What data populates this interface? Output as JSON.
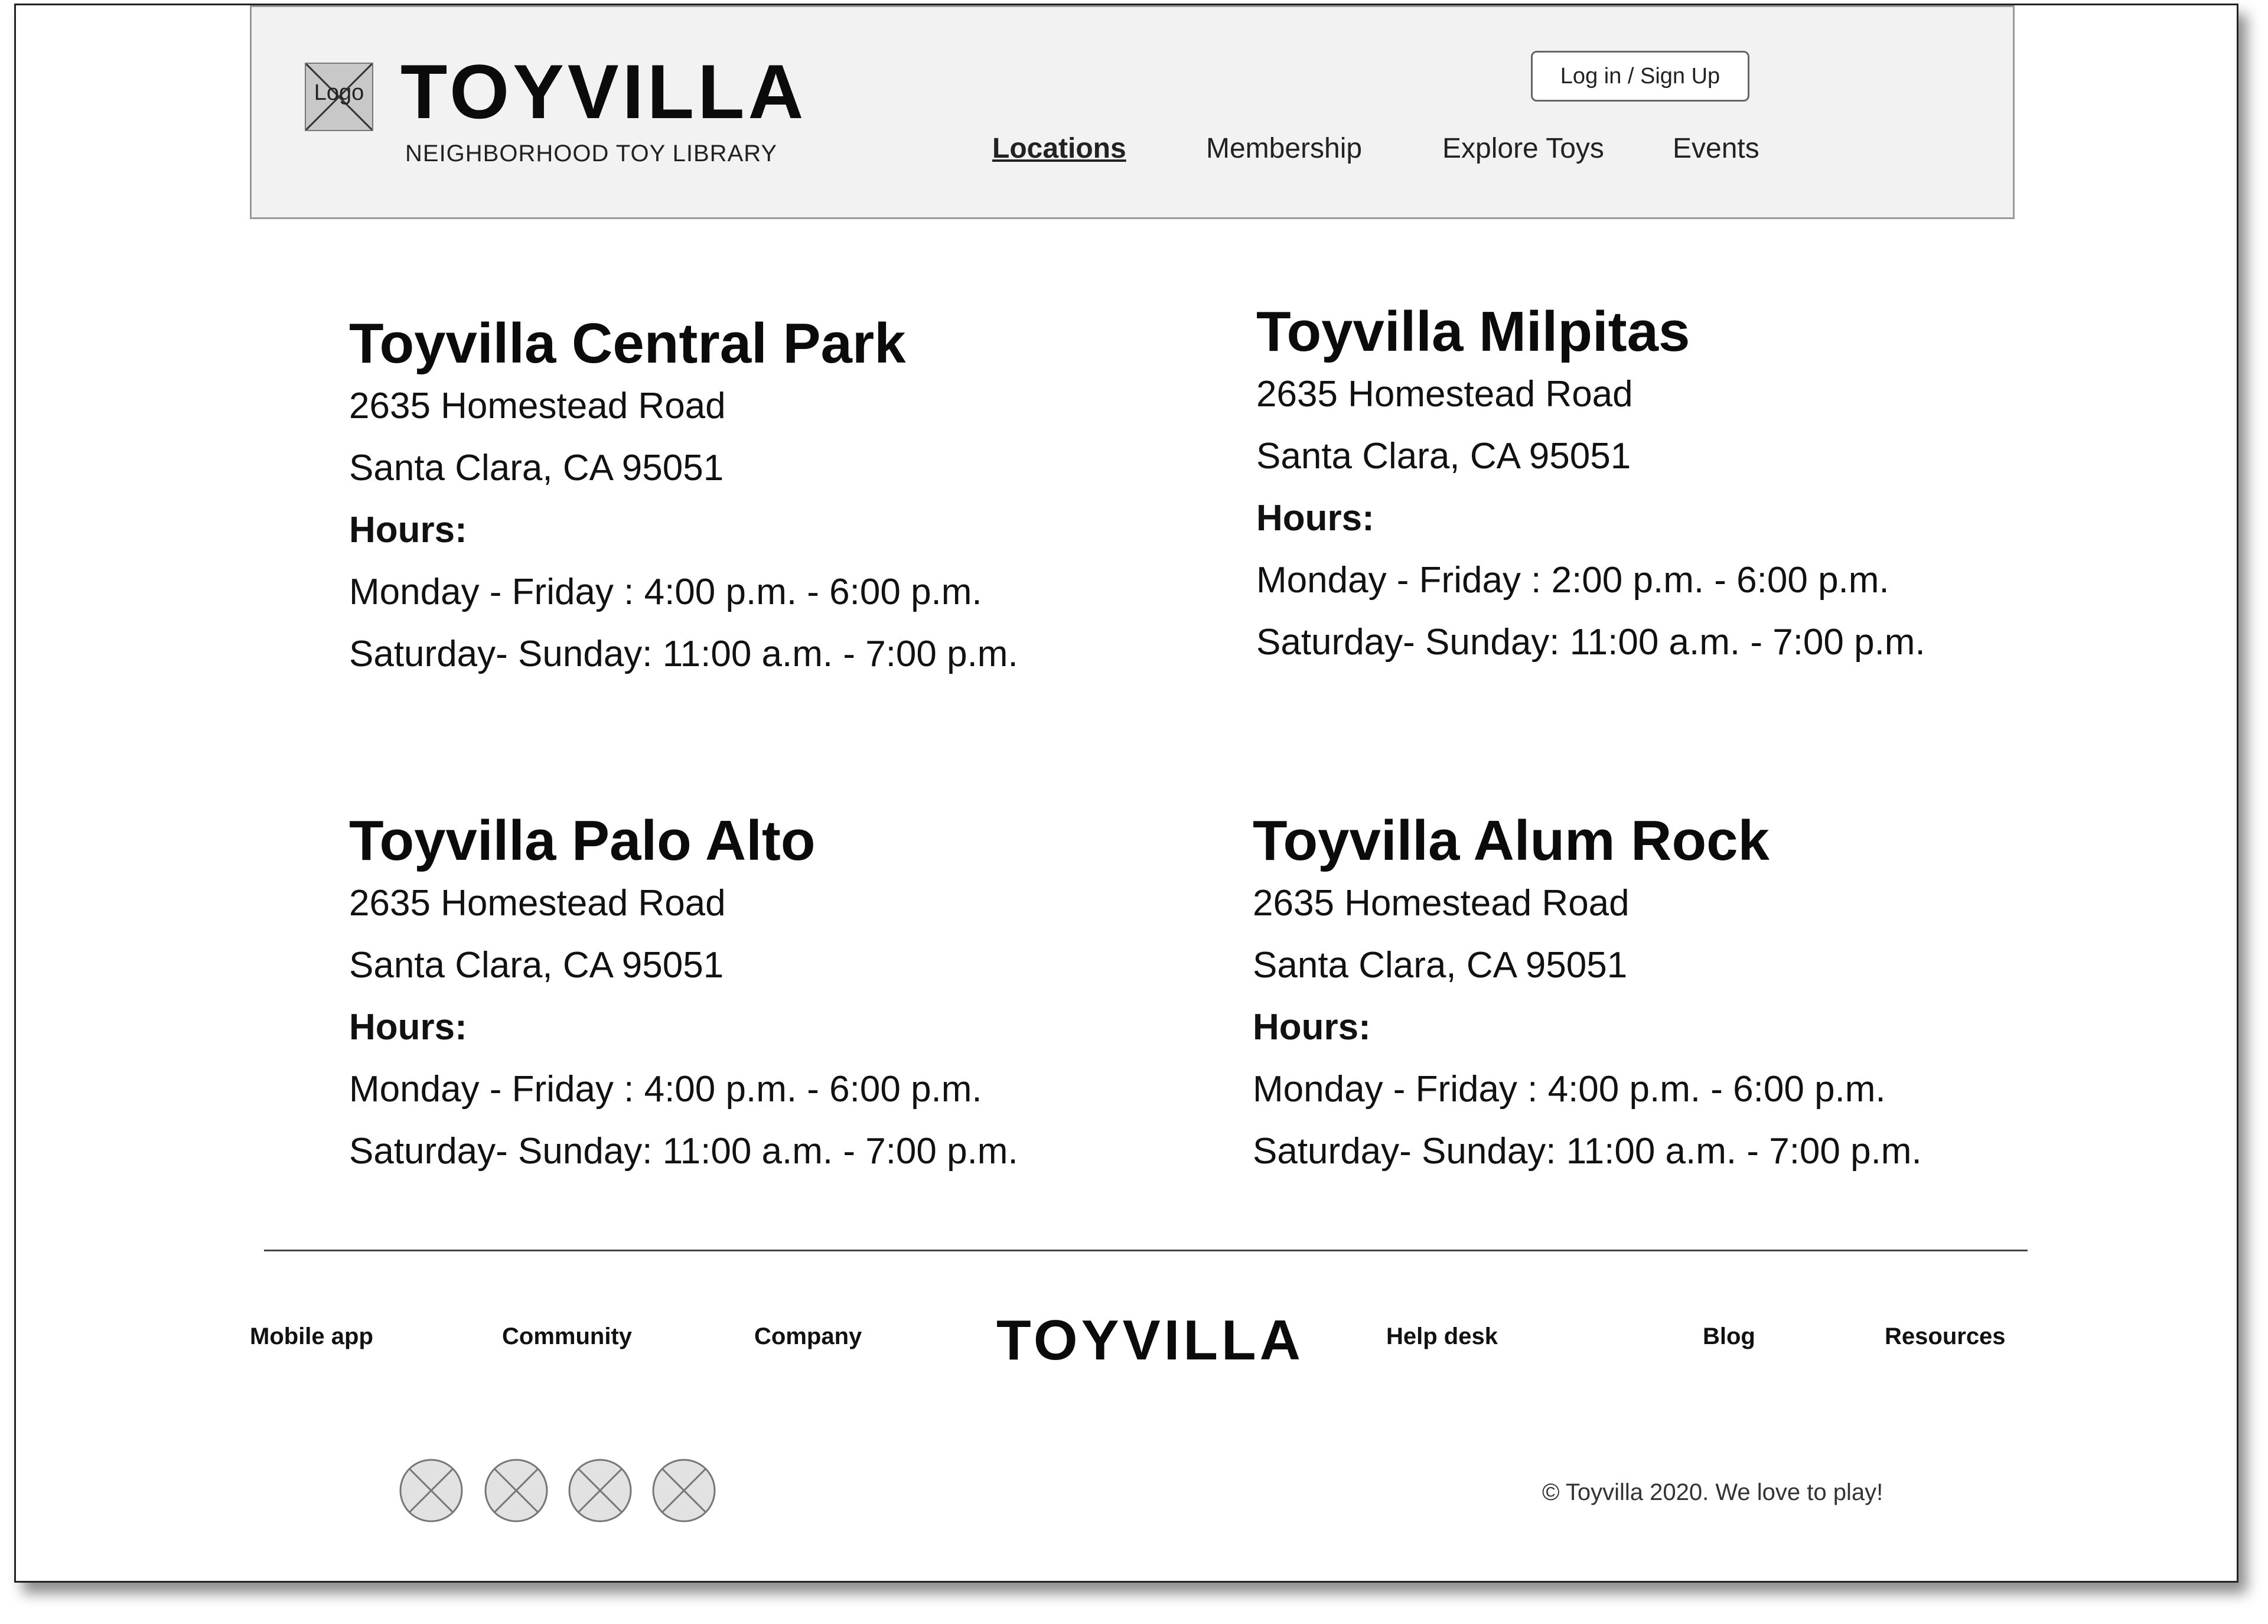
{
  "header": {
    "logo_placeholder": "Logo",
    "brand": "TOYVILLA",
    "tagline": "NEIGHBORHOOD TOY LIBRARY",
    "login_label": "Log in / Sign Up",
    "nav": [
      {
        "label": "Locations",
        "active": true
      },
      {
        "label": "Membership",
        "active": false
      },
      {
        "label": "Explore Toys",
        "active": false
      },
      {
        "label": "Events",
        "active": false
      }
    ]
  },
  "locations": [
    {
      "name": "Toyvilla Central Park",
      "address1": "2635 Homestead Road",
      "address2": "Santa Clara, CA 95051",
      "hours_label": "Hours:",
      "weekday": "Monday - Friday : 4:00 p.m. - 6:00 p.m.",
      "weekend": "Saturday- Sunday: 11:00 a.m. - 7:00 p.m."
    },
    {
      "name": "Toyvilla Milpitas",
      "address1": "2635 Homestead Road",
      "address2": "Santa Clara, CA 95051",
      "hours_label": "Hours:",
      "weekday": "Monday - Friday : 2:00 p.m. - 6:00 p.m.",
      "weekend": "Saturday- Sunday: 11:00 a.m. - 7:00 p.m."
    },
    {
      "name": "Toyvilla Palo Alto",
      "address1": "2635 Homestead Road",
      "address2": "Santa Clara, CA 95051",
      "hours_label": "Hours:",
      "weekday": "Monday - Friday : 4:00 p.m. - 6:00 p.m.",
      "weekend": "Saturday- Sunday: 11:00 a.m. - 7:00 p.m."
    },
    {
      "name": "Toyvilla Alum Rock",
      "address1": "2635 Homestead Road",
      "address2": "Santa Clara, CA 95051",
      "hours_label": "Hours:",
      "weekday": "Monday - Friday : 4:00 p.m. - 6:00 p.m.",
      "weekend": "Saturday- Sunday: 11:00 a.m. - 7:00 p.m."
    }
  ],
  "footer": {
    "links": [
      "Mobile app",
      "Community",
      "Company",
      "Help desk",
      "Blog",
      "Resources"
    ],
    "brand": "TOYVILLA",
    "social_icons": [
      "social-icon-placeholder",
      "social-icon-placeholder",
      "social-icon-placeholder",
      "social-icon-placeholder"
    ],
    "copyright": "© Toyvilla 2020. We love to play!"
  }
}
